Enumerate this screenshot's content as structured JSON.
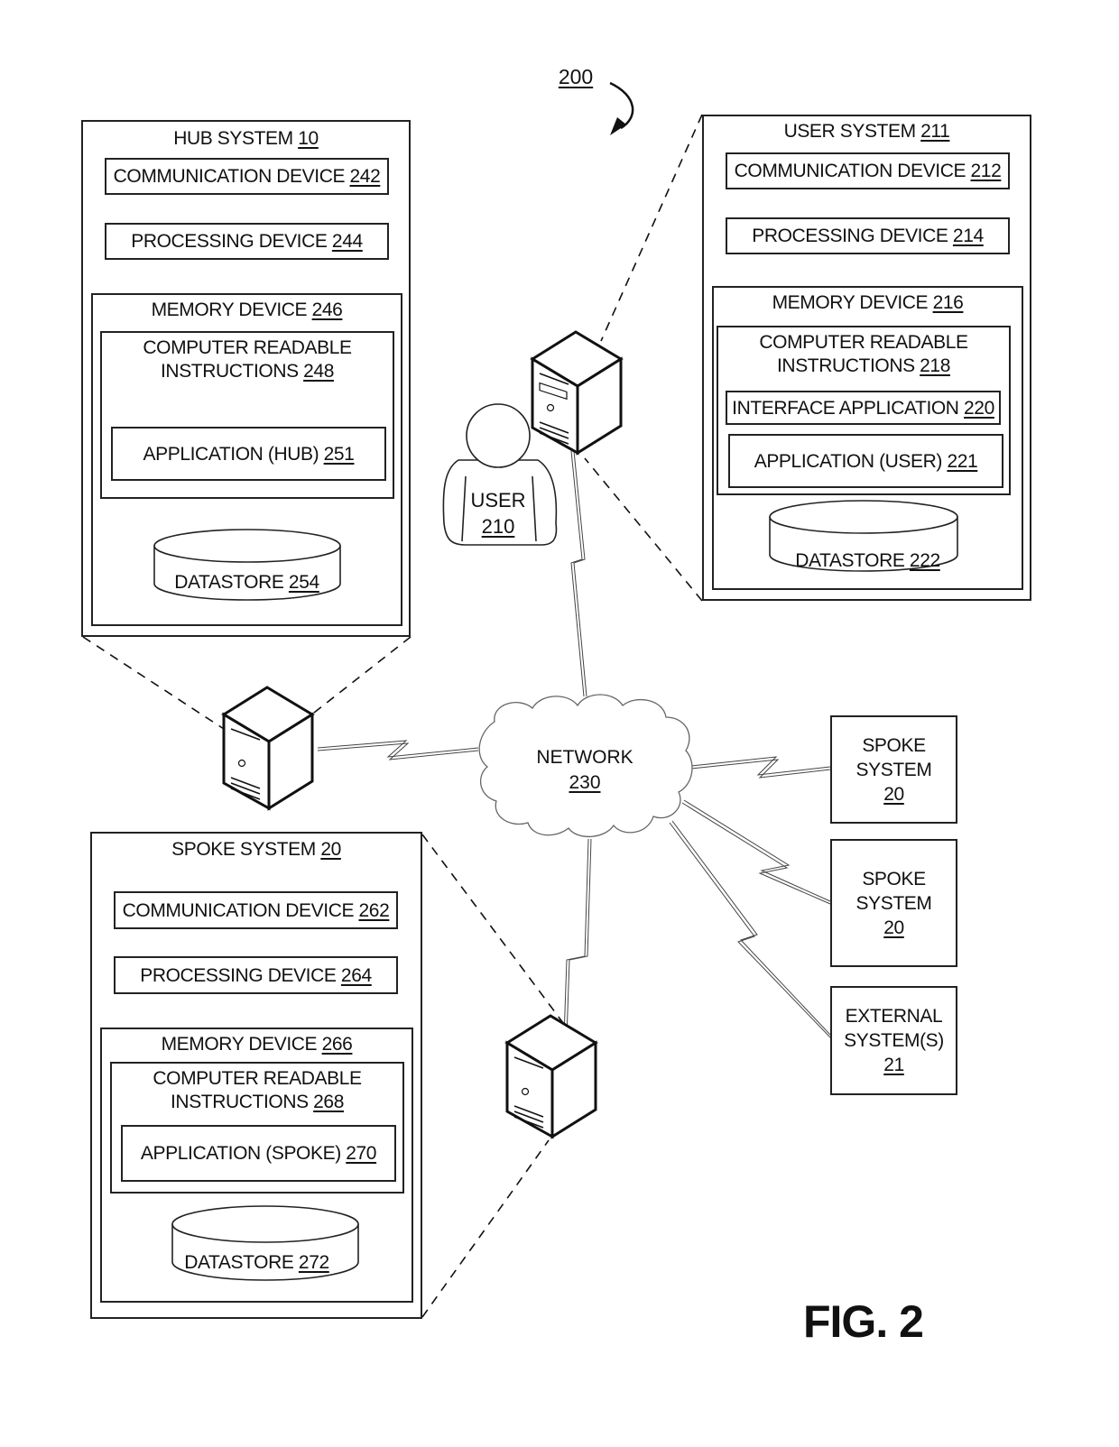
{
  "figure": {
    "ref": "200",
    "caption": "FIG. 2"
  },
  "hub_system": {
    "title": "HUB SYSTEM",
    "ref": "10",
    "communication_device": {
      "label": "COMMUNICATION DEVICE",
      "ref": "242"
    },
    "processing_device": {
      "label": "PROCESSING DEVICE",
      "ref": "244"
    },
    "memory_device": {
      "label": "MEMORY DEVICE",
      "ref": "246"
    },
    "instructions": {
      "line1": "COMPUTER READABLE",
      "line2": "INSTRUCTIONS",
      "ref": "248"
    },
    "application": {
      "label": "APPLICATION (HUB)",
      "ref": "251"
    },
    "datastore": {
      "label": "DATASTORE",
      "ref": "254"
    }
  },
  "user_system": {
    "title": "USER SYSTEM",
    "ref": "211",
    "communication_device": {
      "label": "COMMUNICATION DEVICE",
      "ref": "212"
    },
    "processing_device": {
      "label": "PROCESSING DEVICE",
      "ref": "214"
    },
    "memory_device": {
      "label": "MEMORY DEVICE",
      "ref": "216"
    },
    "instructions": {
      "line1": "COMPUTER READABLE",
      "line2": "INSTRUCTIONS",
      "ref": "218"
    },
    "interface_application": {
      "label": "INTERFACE APPLICATION",
      "ref": "220"
    },
    "application": {
      "label": "APPLICATION (USER)",
      "ref": "221"
    },
    "datastore": {
      "label": "DATASTORE",
      "ref": "222"
    }
  },
  "spoke_system": {
    "title": "SPOKE SYSTEM",
    "ref": "20",
    "communication_device": {
      "label": "COMMUNICATION DEVICE",
      "ref": "262"
    },
    "processing_device": {
      "label": "PROCESSING DEVICE",
      "ref": "264"
    },
    "memory_device": {
      "label": "MEMORY DEVICE",
      "ref": "266"
    },
    "instructions": {
      "line1": "COMPUTER READABLE",
      "line2": "INSTRUCTIONS",
      "ref": "268"
    },
    "application": {
      "label": "APPLICATION (SPOKE)",
      "ref": "270"
    },
    "datastore": {
      "label": "DATASTORE",
      "ref": "272"
    }
  },
  "user": {
    "label": "USER",
    "ref": "210"
  },
  "network": {
    "label": "NETWORK",
    "ref": "230"
  },
  "side_systems": [
    {
      "line1": "SPOKE",
      "line2": "SYSTEM",
      "ref": "20"
    },
    {
      "line1": "SPOKE",
      "line2": "SYSTEM",
      "ref": "20"
    },
    {
      "line1": "EXTERNAL",
      "line2": "SYSTEM(S)",
      "ref": "21"
    }
  ]
}
